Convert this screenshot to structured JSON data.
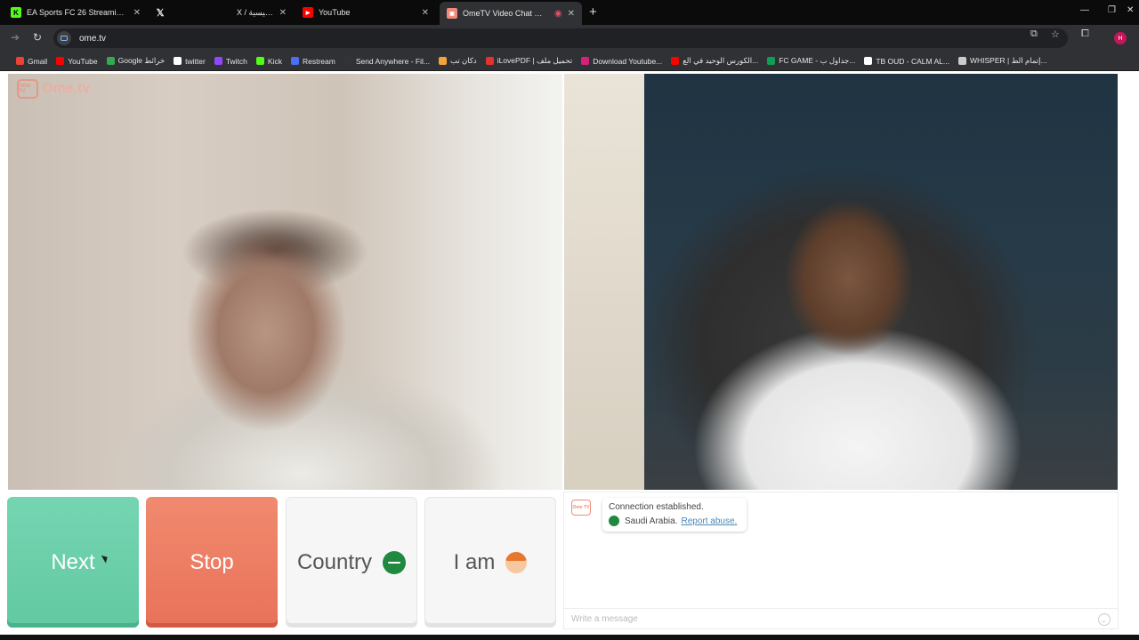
{
  "browser": {
    "tabs": [
      {
        "title": "EA Sports FC 26 Streaming - Li",
        "icon": "kick-icon",
        "color": "#53fc18"
      },
      {
        "title": "",
        "icon": "x-icon",
        "color": "#000000"
      },
      {
        "title": "X / الرئيسية",
        "icon": "x-icon",
        "color": "#000000"
      },
      {
        "title": "YouTube",
        "icon": "youtube-icon",
        "color": "#ff0000"
      },
      {
        "title": "OmeTV Video Chat — Ome",
        "icon": "ometv-icon",
        "color": "#f08a7a"
      }
    ],
    "address": "ome.tv",
    "bookmarks": [
      {
        "label": "Gmail",
        "color": "#ea4335"
      },
      {
        "label": "YouTube",
        "color": "#ff0000"
      },
      {
        "label": "Google خرائط",
        "color": "#34a853"
      },
      {
        "label": "twitter",
        "color": "#ffffff"
      },
      {
        "label": "Twitch",
        "color": "#9146ff"
      },
      {
        "label": "Kick",
        "color": "#53fc18"
      },
      {
        "label": "Restream",
        "color": "#4c6ef5"
      },
      {
        "label": "Send Anywhere - Fil...",
        "color": "#333333"
      },
      {
        "label": "دكان تب",
        "color": "#f2a33a"
      },
      {
        "label": "iLovePDF | تحميل ملف",
        "color": "#e5322d"
      },
      {
        "label": "Download Youtube...",
        "color": "#d6217a"
      },
      {
        "label": "الكورس الوحيد في الع...",
        "color": "#ff0000"
      },
      {
        "label": "FC GAME - جداول ب...",
        "color": "#0f9d58"
      },
      {
        "label": "TB OUD - CALM AL...",
        "color": "#ffffff"
      },
      {
        "label": "WHISPER | إتمام الط...",
        "color": "#cccccc"
      }
    ],
    "profile_initial": "H"
  },
  "app": {
    "logo_text": "Ome.tv",
    "logo_badge": "Ome TV",
    "buttons": {
      "next": "Next",
      "stop": "Stop",
      "country": "Country",
      "i_am": "I am"
    },
    "chat": {
      "status": "Connection established.",
      "country": "Saudi Arabia.",
      "report": "Report abuse.",
      "input_placeholder": "Write a message"
    },
    "colors": {
      "next": "#6bcfaa",
      "stop": "#ec7c63",
      "accent": "#f08a7a"
    }
  }
}
